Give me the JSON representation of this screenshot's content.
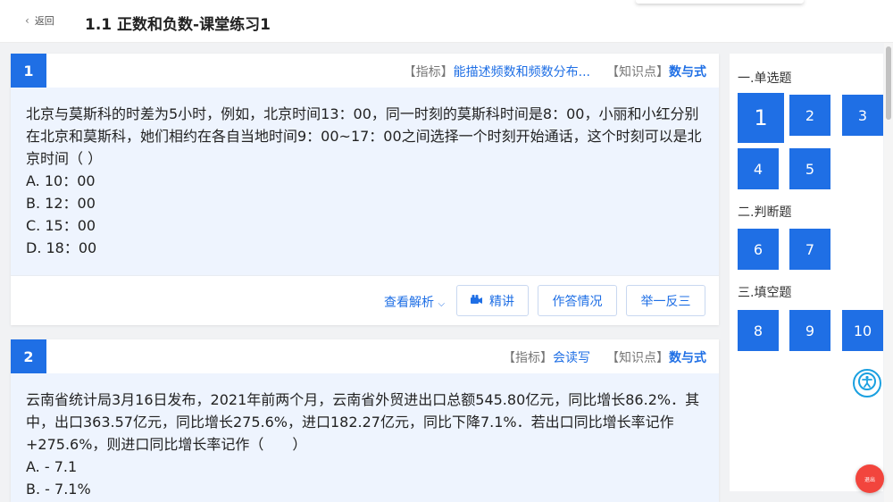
{
  "header": {
    "back_label": "返回",
    "title": "1.1 正数和负数-课堂练习1"
  },
  "questions": [
    {
      "number": "1",
      "indicator_label": "【指标】",
      "indicator_value": "能描述频数和频数分布...",
      "knowledge_label": "【知识点】",
      "knowledge_value": "数与式",
      "stem": "北京与莫斯科的时差为5小时，例如，北京时间13：00，同一时刻的莫斯科时间是8：00，小丽和小红分别在北京和莫斯科，她们相约在各自当地时间9：00~17：00之间选择一个时刻开始通话，这个时刻可以是北京时间（ ）",
      "options": [
        "A.  10：00",
        "B.  12：00",
        "C.  15：00",
        "D.  18：00"
      ],
      "actions": {
        "analysis": "查看解析",
        "explain": "精讲",
        "answers": "作答情况",
        "similar": "举一反三"
      }
    },
    {
      "number": "2",
      "indicator_label": "【指标】",
      "indicator_value": "会读写",
      "knowledge_label": "【知识点】",
      "knowledge_value": "数与式",
      "stem": "云南省统计局3月16日发布，2021年前两个月，云南省外贸进出口总额545.80亿元，同比增长86.2%．其中，出口363.57亿元，同比增长275.6%，进口182.27亿元，同比下降7.1%．若出口同比增长率记作+275.6%，则进口同比增长率记作（　　）",
      "options": [
        "A.   - 7.1",
        "B.   - 7.1%"
      ]
    }
  ],
  "sidebar": {
    "sections": [
      {
        "title": "一.单选题",
        "items": [
          "1",
          "2",
          "3",
          "4",
          "5"
        ]
      },
      {
        "title": "二.判断题",
        "items": [
          "6",
          "7"
        ]
      },
      {
        "title": "三.填空题",
        "items": [
          "8",
          "9",
          "10"
        ]
      }
    ],
    "active_item": "1"
  },
  "floating": {
    "exit_label": "退出"
  },
  "colors": {
    "accent": "#1f6fe5",
    "body_bg": "#eef4fe",
    "exit": "#f2453d"
  }
}
